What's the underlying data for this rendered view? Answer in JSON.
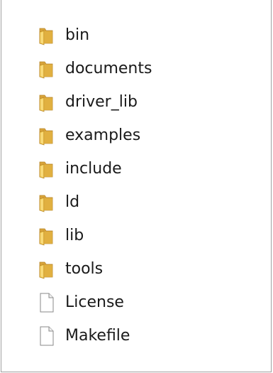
{
  "explorer": {
    "items": [
      {
        "name": "bin",
        "icon": "folder-icon"
      },
      {
        "name": "documents",
        "icon": "folder-icon"
      },
      {
        "name": "driver_lib",
        "icon": "folder-icon"
      },
      {
        "name": "examples",
        "icon": "folder-icon"
      },
      {
        "name": "include",
        "icon": "folder-icon"
      },
      {
        "name": "ld",
        "icon": "folder-icon"
      },
      {
        "name": "lib",
        "icon": "folder-icon"
      },
      {
        "name": "tools",
        "icon": "folder-icon"
      },
      {
        "name": "License",
        "icon": "file-icon"
      },
      {
        "name": "Makefile",
        "icon": "file-icon"
      }
    ],
    "colors": {
      "folder_front": "#f2c94c",
      "folder_back": "#d9a43a",
      "folder_edge": "#b8862a",
      "file_fill": "#ffffff",
      "file_edge": "#8a8a8a"
    }
  }
}
